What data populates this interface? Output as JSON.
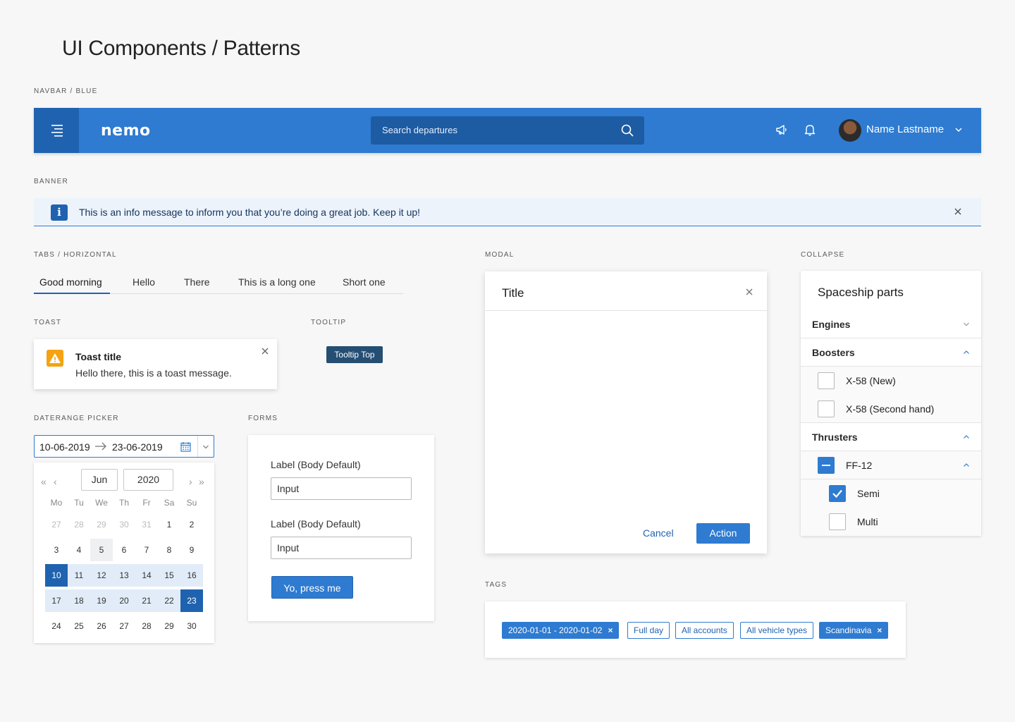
{
  "page_title": "UI Components / Patterns",
  "sections": {
    "navbar": "NAVBAR / BLUE",
    "banner": "BANNER",
    "tabs": "TABS / HORIZONTAL",
    "toast": "TOAST",
    "tooltip": "TOOLTIP",
    "daterange": "DATERANGE PICKER",
    "forms": "FORMS",
    "modal": "MODAL",
    "collapse": "COLLAPSE",
    "tags": "TAGS"
  },
  "navbar": {
    "logo": "nemo",
    "search_placeholder": "Search departures",
    "user_name": "Name Lastname",
    "icons": [
      "menu-icon",
      "search-icon",
      "megaphone-icon",
      "bell-icon",
      "avatar",
      "chevron-down-icon"
    ]
  },
  "banner": {
    "message": "This is an info message to inform you that you’re doing a great job. Keep it up!",
    "icon": "info-icon"
  },
  "tabs": {
    "items": [
      "Good morning",
      "Hello",
      "There",
      "This is a long one",
      "Short one"
    ],
    "active": "Good morning"
  },
  "toast": {
    "title": "Toast title",
    "message": "Hello there, this is a toast message.",
    "icon": "warning-icon"
  },
  "tooltip": {
    "text": "Tooltip Top"
  },
  "daterange": {
    "from": "10-06-2019",
    "to": "23-06-2019",
    "month": "Jun",
    "year": "2020",
    "weekdays": [
      "Mo",
      "Tu",
      "We",
      "Th",
      "Fr",
      "Sa",
      "Su"
    ],
    "weeks": [
      [
        "27",
        "28",
        "29",
        "30",
        "31",
        "1",
        "2"
      ],
      [
        "3",
        "4",
        "5",
        "6",
        "7",
        "8",
        "9"
      ],
      [
        "10",
        "11",
        "12",
        "13",
        "14",
        "15",
        "16"
      ],
      [
        "17",
        "18",
        "19",
        "20",
        "21",
        "22",
        "23"
      ],
      [
        "24",
        "25",
        "26",
        "27",
        "28",
        "29",
        "30"
      ]
    ]
  },
  "forms": {
    "label1": "Label (Body Default)",
    "input1": "Input",
    "label2": "Label (Body Default)",
    "input2": "Input",
    "button": "Yo, press me"
  },
  "modal": {
    "title": "Title",
    "cancel": "Cancel",
    "action": "Action"
  },
  "collapse": {
    "title": "Spaceship parts",
    "engines": "Engines",
    "boosters": "Boosters",
    "booster_items": [
      "X-58 (New)",
      "X-58 (Second hand)"
    ],
    "thrusters": "Thrusters",
    "ff12": "FF-12",
    "ff12_items": [
      "Semi",
      "Multi"
    ]
  },
  "tags": {
    "items": [
      "2020-01-01 - 2020-01-02",
      "Full day",
      "All accounts",
      "All vehicle types",
      "Scandinavia"
    ]
  },
  "colors": {
    "primary": "#2e7bd1",
    "primary_dark": "#1f63b0",
    "tooltip": "#254e73",
    "warning": "#f5a310",
    "banner_bg": "#ecf3fb"
  }
}
